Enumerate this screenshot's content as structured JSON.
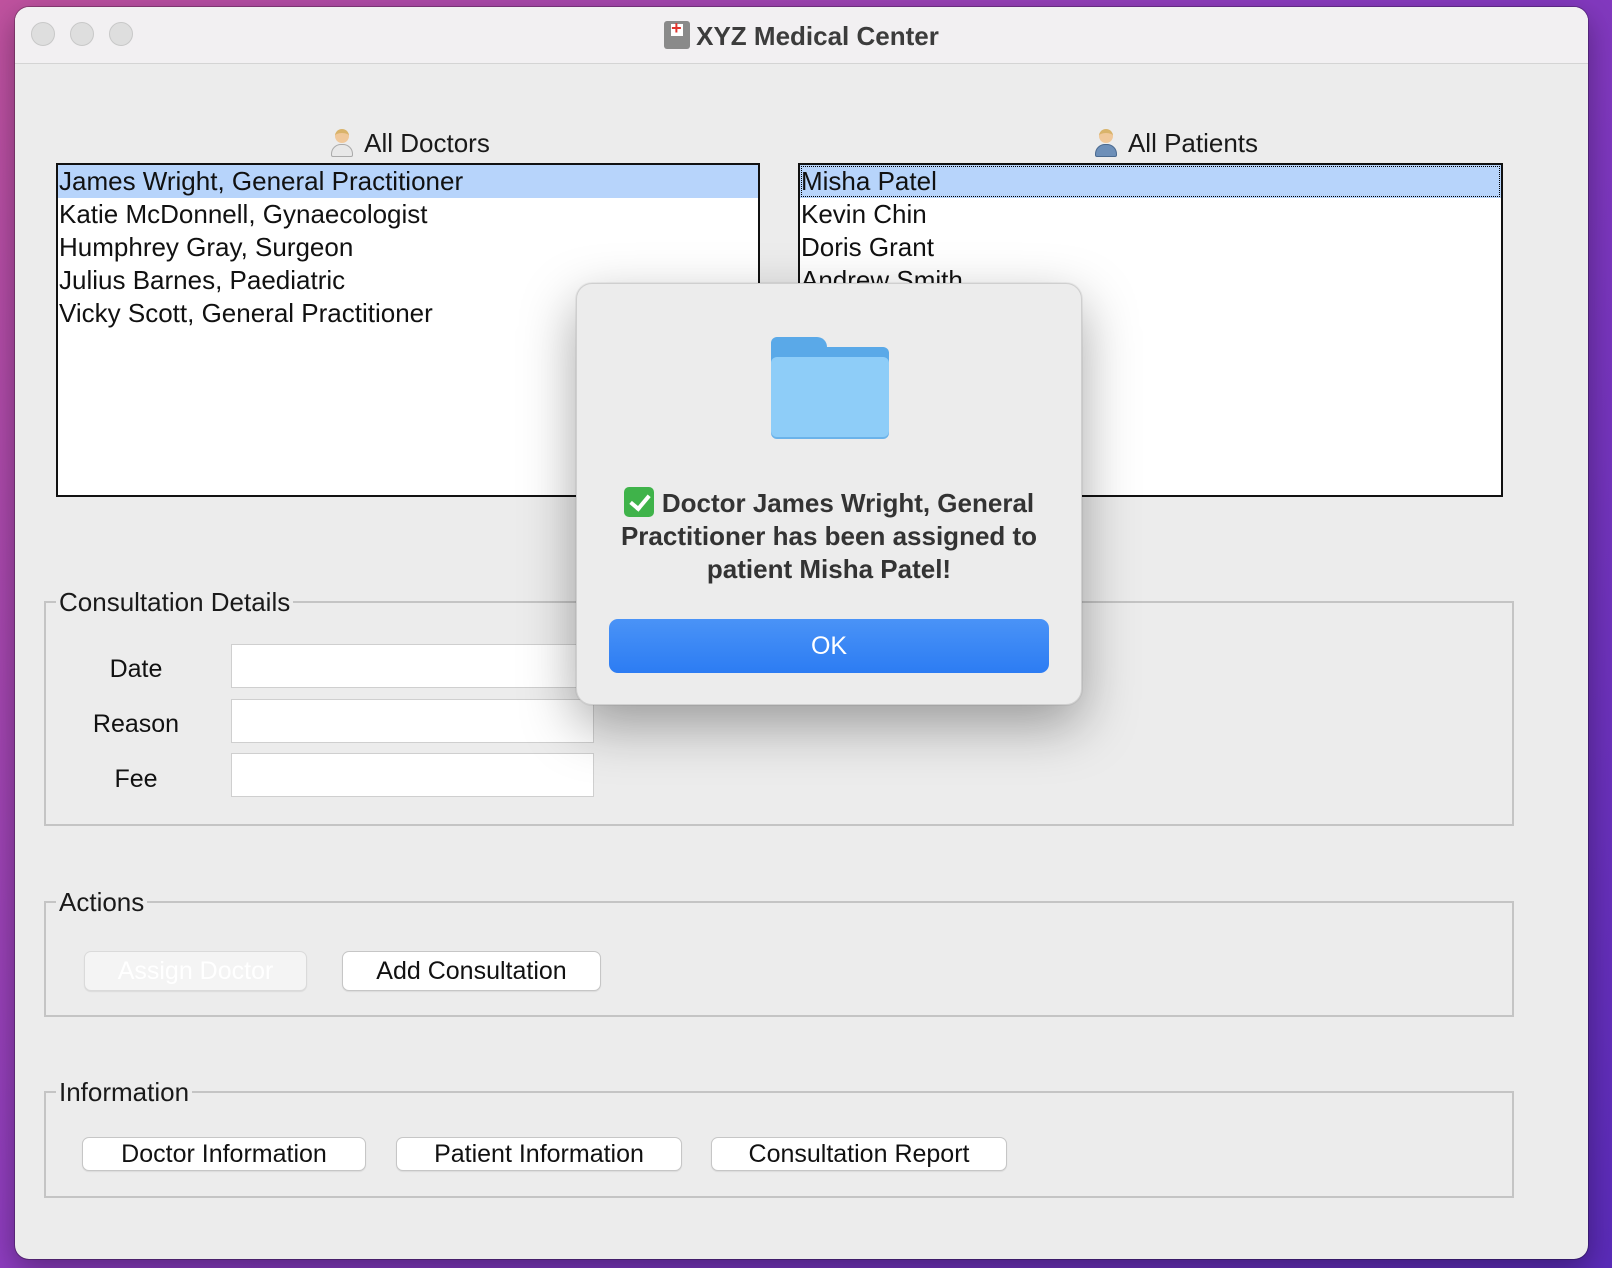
{
  "window": {
    "title": "XYZ Medical Center"
  },
  "doctors": {
    "heading": "All Doctors",
    "items": [
      "James Wright, General Practitioner",
      "Katie McDonnell, Gynaecologist",
      "Humphrey Gray, Surgeon",
      "Julius Barnes, Paediatric",
      "Vicky Scott, General Practitioner"
    ],
    "selected_index": 0
  },
  "patients": {
    "heading": "All Patients",
    "items": [
      "Misha Patel",
      "Kevin Chin",
      "Doris Grant",
      "Andrew Smith"
    ],
    "selected_index": 0
  },
  "consultation": {
    "group_label": "Consultation Details",
    "date_label": "Date",
    "reason_label": "Reason",
    "fee_label": "Fee",
    "date_value": "",
    "reason_value": "",
    "fee_value": ""
  },
  "actions": {
    "group_label": "Actions",
    "assign_doctor": "Assign Doctor",
    "add_consultation": "Add Consultation"
  },
  "information": {
    "group_label": "Information",
    "doctor_info": "Doctor Information",
    "patient_info": "Patient Information",
    "consultation_report": "Consultation Report"
  },
  "dialog": {
    "message": "Doctor James Wright, General Practitioner has been assigned to patient Misha Patel!",
    "ok_label": "OK",
    "icon": "folder-icon",
    "status_icon": "check-mark-icon"
  },
  "colors": {
    "selection": "#b7d4fb",
    "ok_button": "#2c7cf3",
    "check": "#3fb34a"
  }
}
